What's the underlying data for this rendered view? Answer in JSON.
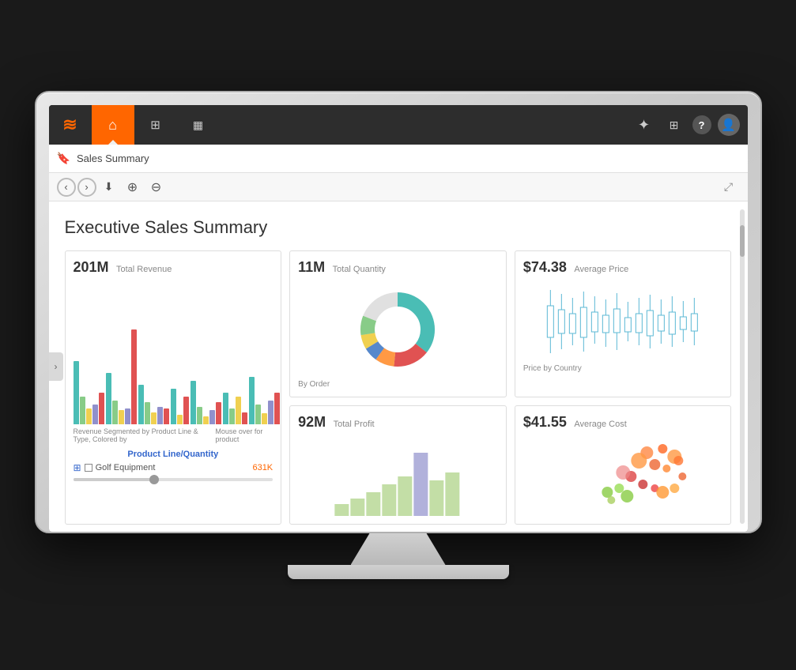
{
  "topbar": {
    "logo_symbol": "≋",
    "nav_items": [
      {
        "id": "home",
        "icon": "⌂",
        "active": true
      },
      {
        "id": "tree",
        "icon": "⊞",
        "active": false
      },
      {
        "id": "book",
        "icon": "📋",
        "active": false
      }
    ],
    "right_icons": [
      {
        "id": "sparkle",
        "icon": "✦",
        "label": "sparkle-icon"
      },
      {
        "id": "keyboard",
        "icon": "⌨",
        "label": "keyboard-icon"
      },
      {
        "id": "help",
        "icon": "?",
        "label": "help-icon"
      },
      {
        "id": "user",
        "icon": "👤",
        "label": "user-icon"
      }
    ]
  },
  "breadcrumb": {
    "icon": "🔖",
    "text": "Sales Summary"
  },
  "toolbar": {
    "buttons": [
      {
        "id": "back",
        "icon": "‹",
        "label": "back-button"
      },
      {
        "id": "forward",
        "icon": "›",
        "label": "forward-button"
      },
      {
        "id": "download",
        "icon": "↓",
        "label": "download-button"
      },
      {
        "id": "zoom-in",
        "icon": "⊕",
        "label": "zoom-in-button"
      },
      {
        "id": "zoom-out",
        "icon": "⊖",
        "label": "zoom-out-button"
      }
    ],
    "expand_icon": "⤢"
  },
  "report": {
    "title": "Executive Sales Summary",
    "widgets": [
      {
        "id": "total-revenue",
        "metric": "201M",
        "label": "Total Revenue",
        "chart_type": "bar",
        "footer": "Revenue Segmented by Product Line & Type, Colored by",
        "footer2": "Mouse over for product",
        "legend_title": "Product Line/Quantity",
        "legend_items": [
          {
            "icon": "⊞",
            "name": "Golf Equipment",
            "value": "631K"
          }
        ]
      },
      {
        "id": "total-quantity",
        "metric": "11M",
        "label": "Total Quantity",
        "chart_type": "donut",
        "footer": "By Order"
      },
      {
        "id": "average-price",
        "metric": "$74.38",
        "label": "Average Price",
        "chart_type": "candlestick",
        "footer": "Price by Country"
      },
      {
        "id": "total-profit",
        "metric": "92M",
        "label": "Total Profit",
        "chart_type": "area"
      },
      {
        "id": "average-cost",
        "metric": "$41.55",
        "label": "Average Cost",
        "chart_type": "scatter"
      }
    ]
  },
  "colors": {
    "orange": "#ff6600",
    "teal": "#4abdb5",
    "red": "#e05252",
    "yellow": "#f0d050",
    "purple": "#9090cc",
    "green": "#88cc88",
    "blue_light": "#5bb8d4",
    "coral": "#e07060",
    "lime": "#aad080"
  }
}
